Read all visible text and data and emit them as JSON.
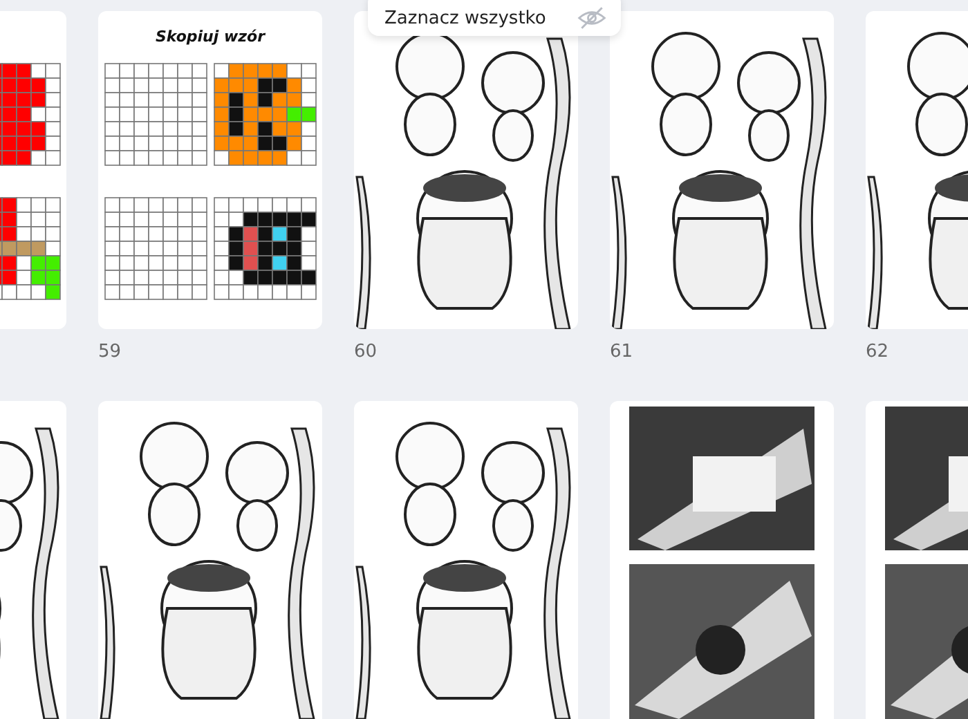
{
  "tooltip": {
    "label": "Zaznacz wszystko"
  },
  "rows": [
    {
      "pages": [
        {
          "kind": "pattern"
        },
        {
          "kind": "pattern",
          "title": "Skopiuj wzór",
          "number": "59"
        },
        {
          "kind": "picture",
          "number": "60"
        },
        {
          "kind": "picture",
          "number": "61"
        },
        {
          "kind": "picture",
          "number": "62"
        }
      ]
    },
    {
      "pages": [
        {
          "kind": "picture"
        },
        {
          "kind": "picture"
        },
        {
          "kind": "picture"
        },
        {
          "kind": "picture"
        },
        {
          "kind": "picture"
        }
      ]
    }
  ]
}
